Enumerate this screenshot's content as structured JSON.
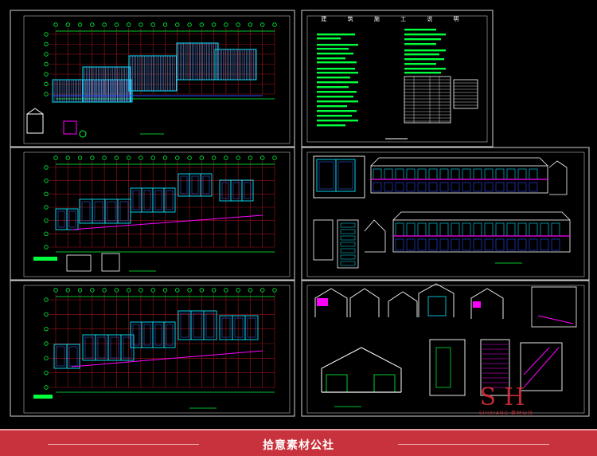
{
  "notes_sheet": {
    "title": "建 筑 施 工 说 明"
  },
  "watermark": {
    "big": "SH",
    "sub": "SHIXIANG 素材公社"
  },
  "footer": {
    "text": "拾意素材公社"
  },
  "colors": {
    "background": "#000000",
    "frame": "#cfcfcf",
    "dimension_green": "#00ff3c",
    "grid_red": "#a0141e",
    "wall_cyan": "#00e5ff",
    "wall_blue": "#2a4bff",
    "accent_magenta": "#ff00ff",
    "white": "#ffffff",
    "footer_red": "#c8323c"
  }
}
